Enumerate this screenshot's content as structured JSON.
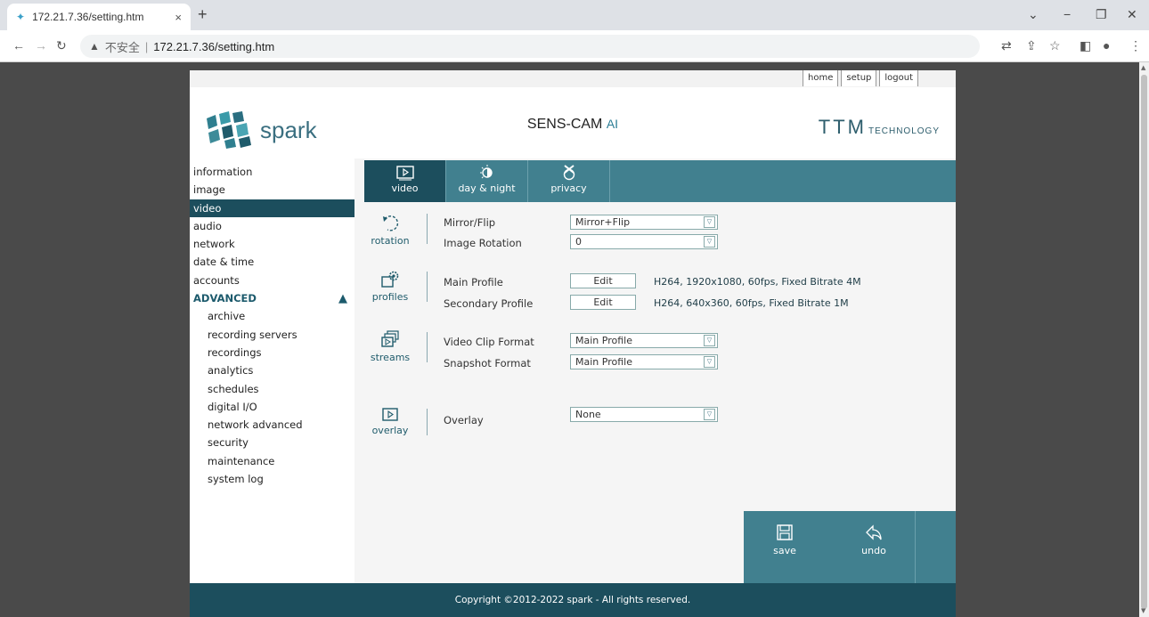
{
  "browser": {
    "tab_title": "172.21.7.36/setting.htm",
    "tab_close": "×",
    "new_tab": "+",
    "url_insecure": "不安全",
    "url_separator": "|",
    "url": "172.21.7.36/setting.htm",
    "win_minimize": "−",
    "win_restore": "❐",
    "win_close": "✕",
    "win_dropdown": "⌄"
  },
  "toplinks": [
    "home",
    "setup",
    "logout"
  ],
  "brand": {
    "logo_text": "spark",
    "product": "SENS-CAM",
    "product_suffix": "AI",
    "vendor_big": "TTM",
    "vendor_small": "TECHNOLOGY"
  },
  "sidebar": {
    "items": [
      "information",
      "image",
      "video",
      "audio",
      "network",
      "date & time",
      "accounts"
    ],
    "active": "video",
    "advanced_label": "ADVANCED",
    "advanced_items": [
      "archive",
      "recording servers",
      "recordings",
      "analytics",
      "schedules",
      "digital I/O",
      "network advanced",
      "security",
      "maintenance",
      "system log"
    ]
  },
  "tabs": [
    {
      "label": "video",
      "icon": "video-icon"
    },
    {
      "label": "day & night",
      "icon": "day-night-icon"
    },
    {
      "label": "privacy",
      "icon": "privacy-icon"
    }
  ],
  "sections": {
    "rotation": {
      "label": "rotation",
      "mirror_label": "Mirror/Flip",
      "mirror_value": "Mirror+Flip",
      "rotation_label": "Image Rotation",
      "rotation_value": "0"
    },
    "profiles": {
      "label": "profiles",
      "main_label": "Main Profile",
      "main_button": "Edit",
      "main_info": "H264, 1920x1080, 60fps, Fixed Bitrate 4M",
      "secondary_label": "Secondary Profile",
      "secondary_button": "Edit",
      "secondary_info": "H264, 640x360, 60fps, Fixed Bitrate 1M"
    },
    "streams": {
      "label": "streams",
      "clip_label": "Video Clip Format",
      "clip_value": "Main Profile",
      "snapshot_label": "Snapshot Format",
      "snapshot_value": "Main Profile"
    },
    "overlay": {
      "label": "overlay",
      "overlay_label": "Overlay",
      "overlay_value": "None"
    }
  },
  "actions": {
    "save": "save",
    "undo": "undo"
  },
  "footer": "Copyright ©2012-2022 spark - All rights reserved.",
  "colors": {
    "accent_dark": "#1c4e5d",
    "accent": "#41808f",
    "brand_text": "#3a6f80"
  }
}
